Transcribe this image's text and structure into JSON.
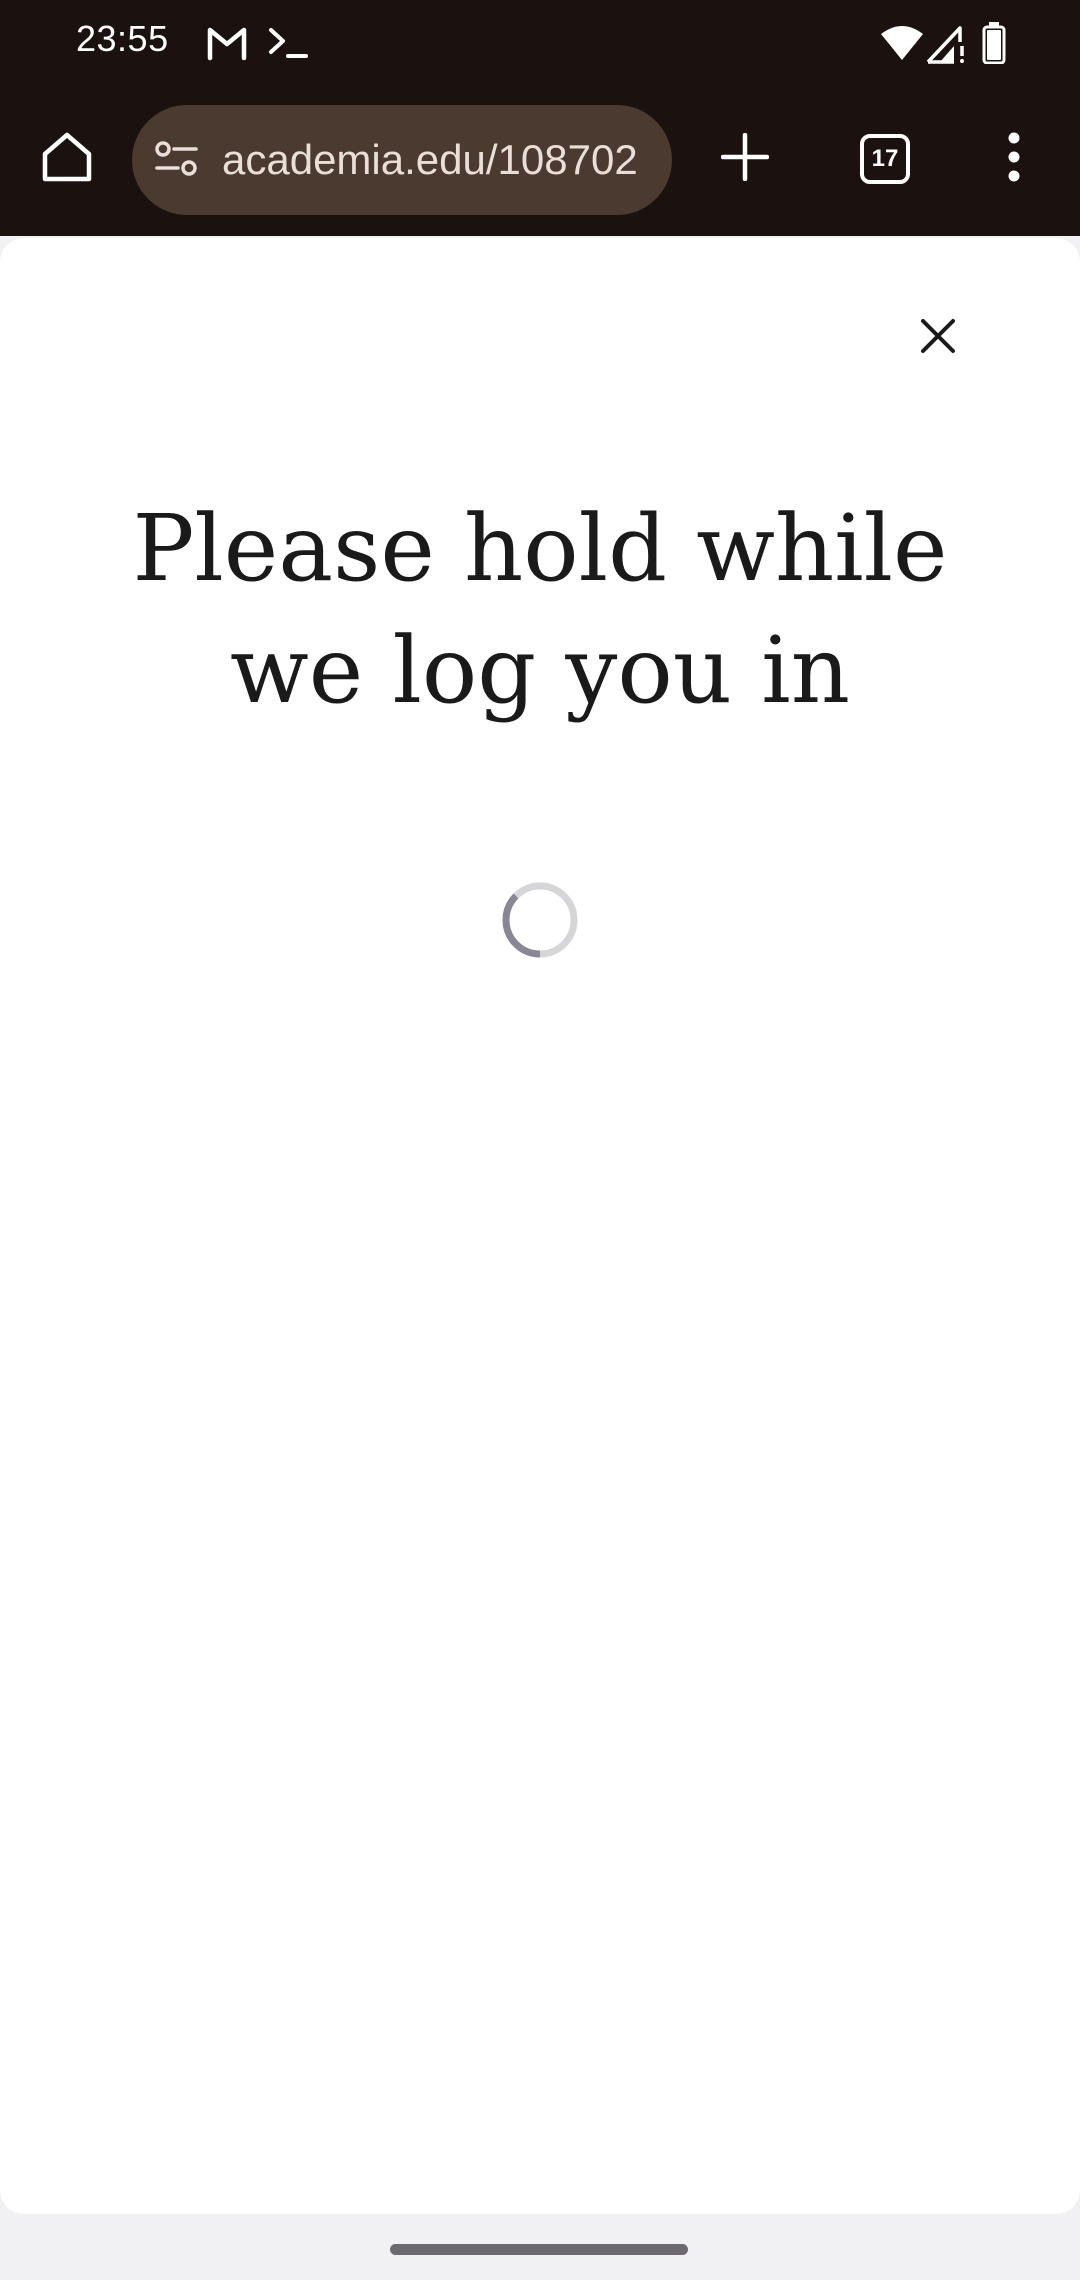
{
  "status_bar": {
    "time": "23:55",
    "icons": [
      "gmail-icon",
      "terminal-icon",
      "wifi-icon",
      "signal-icon",
      "battery-icon"
    ]
  },
  "toolbar": {
    "url": "academia.edu/108702",
    "tab_count": "17",
    "icons": [
      "home-icon",
      "site-settings-icon",
      "new-tab-icon",
      "tab-switcher-icon",
      "more-menu-icon"
    ]
  },
  "sheet": {
    "heading_line1": "Please hold while",
    "heading_line2": "we log you in",
    "close_icon": "close-icon",
    "spinner_icon": "loading-spinner-icon"
  },
  "colors": {
    "toolbar_bg": "#1b1210",
    "url_pill_bg": "#4b3a2f",
    "sheet_bg": "#ffffff",
    "spinner_track": "#d6d6d8",
    "spinner_arc": "#8a8795"
  }
}
